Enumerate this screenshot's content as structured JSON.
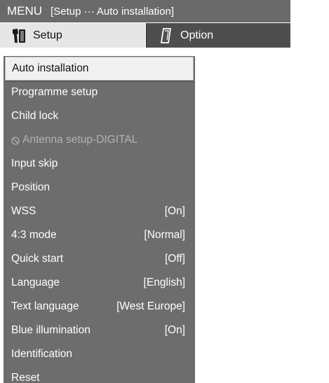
{
  "menu": {
    "title": "MENU",
    "path": "[Setup ··· Auto installation]"
  },
  "tabs": [
    {
      "label": "Setup",
      "icon": "setup-icon",
      "active": true
    },
    {
      "label": "Option",
      "icon": "option-icon",
      "active": false
    }
  ],
  "items": [
    {
      "label": "Auto installation",
      "value": "",
      "selected": true
    },
    {
      "label": "Programme setup",
      "value": ""
    },
    {
      "label": "Child lock",
      "value": ""
    },
    {
      "label": "Antenna setup-DIGITAL",
      "value": "",
      "disabled": true,
      "icon": "prohibited-icon"
    },
    {
      "label": "Input skip",
      "value": ""
    },
    {
      "label": "Position",
      "value": ""
    },
    {
      "label": "WSS",
      "value": "[On]"
    },
    {
      "label": "4:3 mode",
      "value": "[Normal]"
    },
    {
      "label": "Quick start",
      "value": "[Off]"
    },
    {
      "label": "Language",
      "value": "[English]"
    },
    {
      "label": "Text language",
      "value": "[West Europe]"
    },
    {
      "label": "Blue illumination",
      "value": "[On]"
    },
    {
      "label": "Identification",
      "value": ""
    },
    {
      "label": "Reset",
      "value": ""
    }
  ],
  "colors": {
    "title_bar": "#6a6a6a",
    "tab_active": "#e6e6e6",
    "tab_inactive": "#4e4e4e",
    "list_bg": "#6d6d6d",
    "selected_bg": "#f0f0f0",
    "disabled_text": "#b2b2b2"
  }
}
